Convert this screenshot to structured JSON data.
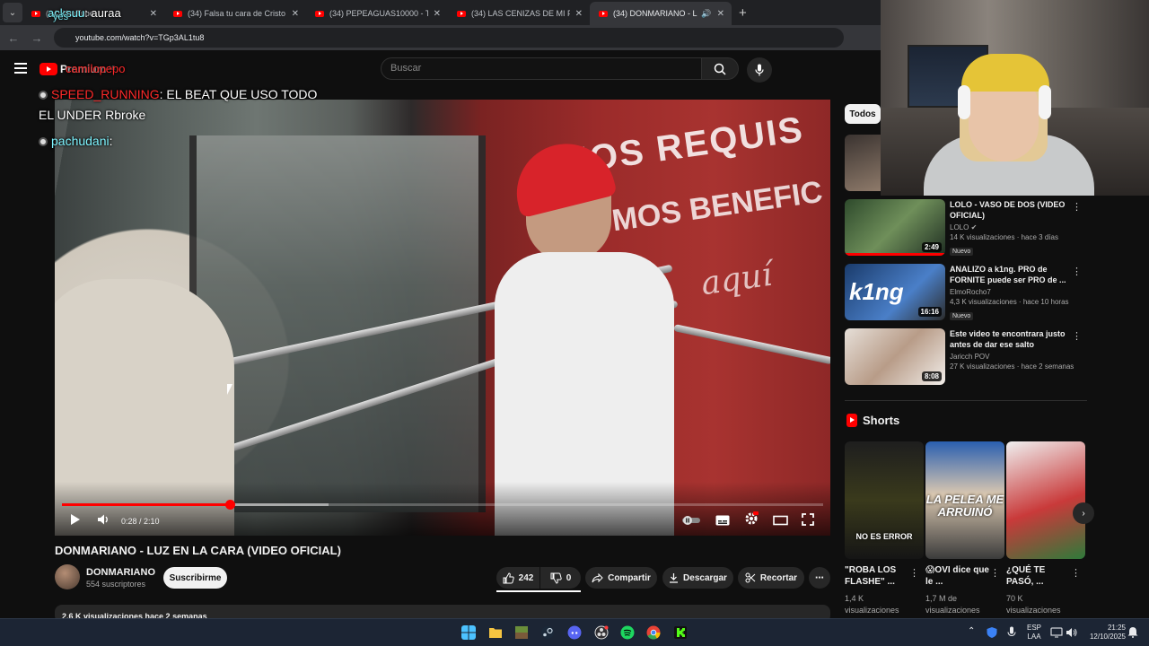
{
  "browser": {
    "tabs": [
      {
        "label": "(34) YouTube",
        "active": false
      },
      {
        "label": "(34) Falsa tu cara de Cristo - Yo",
        "active": false
      },
      {
        "label": "(34) PEPEAGUAS10000 - TREN",
        "active": false
      },
      {
        "label": "(34) LAS CENIZAS DE MI PADRE",
        "active": false
      },
      {
        "label": "(34) DONMARIANO - LUZ E",
        "active": true
      }
    ],
    "url": "youtube.com/watch?v=TGp3AL1tu8"
  },
  "youtube": {
    "logo_text": "Premium",
    "logo_region": "AR",
    "search_placeholder": "Buscar",
    "video": {
      "time_current": "0:28",
      "time_total": "2:10",
      "time_display": "0:28 / 2:10",
      "progress": 0.22,
      "buffered": 0.35,
      "sign_text_1": "MOS REQUIS",
      "sign_text_2": "MOS BENEFIC",
      "sign_text_3": "aquí"
    },
    "title": "DONMARIANO - LUZ EN LA CARA (VIDEO OFICIAL)",
    "channel": {
      "name": "DONMARIANO",
      "subs": "554 suscriptores"
    },
    "subscribe_label": "Suscribirme",
    "likes": "242",
    "dislikes": "0",
    "share_label": "Compartir",
    "download_label": "Descargar",
    "clip_label": "Recortar",
    "description_partial": "2,6 K visualizaciones  hace 2 semanas",
    "chip_label": "Todos",
    "recommendations": [
      {
        "title": "LOLO - VASO DE DOS (VIDEO OFICIAL)",
        "channel": "LOLO",
        "meta": "14 K visualizaciones · hace 3 días",
        "duration": "2:49",
        "badge": "Nuevo"
      },
      {
        "title": "ANALIZO a k1ng. PRO de FORNITE puede ser PRO de ...",
        "channel": "ElmoRocho7",
        "meta": "4,3 K visualizaciones · hace 10 horas",
        "duration": "16:16",
        "badge": "Nuevo",
        "thumb_text": "k1ng"
      },
      {
        "title": "Este video te encontrara justo antes de dar ese salto",
        "channel": "Jaricch POV",
        "meta": "27 K visualizaciones · hace 2 semanas",
        "duration": "8:08",
        "badge": ""
      }
    ],
    "shorts_heading": "Shorts",
    "shorts": [
      {
        "title": "\"ROBA LOS FLASHE\" ...",
        "views": "1,4 K visualizaciones",
        "caption": "NO ES ERROR"
      },
      {
        "title": "😱OVI dice que le ...",
        "views": "1,7 M de visualizaciones",
        "caption": "LA PELEA ME ARRUINÓ"
      },
      {
        "title": "¿QUÉ TE PASÓ, ...",
        "views": "70 K visualizaciones",
        "caption": ""
      }
    ]
  },
  "overlay_chat": {
    "line1_name": "acksuu",
    "line1_text": ": auraa",
    "line2_name": "yes",
    "line3_name": "camilopepo",
    "line4_name": "SPEED_RUNNING",
    "line4_text": ": EL BEAT QUE USO TODO",
    "line5_text": "EL UNDER Rbroke",
    "line6_name": "pachudani",
    "line6_text": ":"
  },
  "taskbar": {
    "language": "ESP",
    "layout": "LAA",
    "time": "21:25",
    "date": "12/10/2025"
  },
  "colors": {
    "accent": "#ff0000",
    "bg": "#0f0f0f",
    "chip": "#272727"
  }
}
